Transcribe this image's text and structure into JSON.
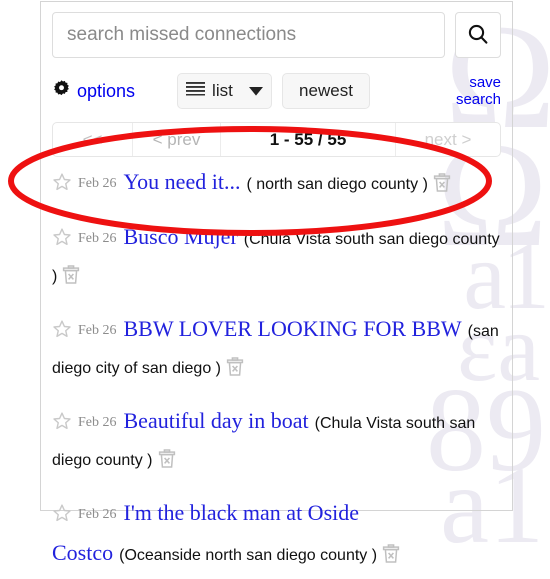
{
  "search": {
    "placeholder": "search missed connections",
    "value": "",
    "search_icon": "magnifier-icon"
  },
  "toolbar": {
    "options_label": "options",
    "options_icon": "gear-icon",
    "view_label": "list",
    "view_icon": "list-lines-icon",
    "view_caret_icon": "chevron-down-icon",
    "sort_label": "newest",
    "save_search_line1": "save",
    "save_search_line2": "search"
  },
  "pagination": {
    "first_label": "<<",
    "prev_label": "< prev",
    "range_label": "1 - 55 / 55",
    "next_label": "next >"
  },
  "results": [
    {
      "favorite_icon": "star-outline-icon",
      "date": "Feb 26",
      "title": "You need it...",
      "location": "( north san diego county )",
      "hide_icon": "trash-x-icon"
    },
    {
      "favorite_icon": "star-outline-icon",
      "date": "Feb 26",
      "title": "Busco Mujer",
      "location": "(Chula Vista south san diego county )",
      "hide_icon": "trash-x-icon"
    },
    {
      "favorite_icon": "star-outline-icon",
      "date": "Feb 26",
      "title": "BBW LOVER LOOKING FOR BBW",
      "location": "(san diego city of san diego )",
      "hide_icon": "trash-x-icon"
    },
    {
      "favorite_icon": "star-outline-icon",
      "date": "Feb 26",
      "title": "Beautiful day in boat",
      "location": "(Chula Vista south san diego county )",
      "hide_icon": "trash-x-icon"
    },
    {
      "favorite_icon": "star-outline-icon",
      "date": "Feb 26",
      "title": "I'm the black man at Oside Costco",
      "location": "(Oceanside north san diego county )",
      "hide_icon": "trash-x-icon"
    }
  ],
  "annotation": {
    "shape": "red-ellipse-highlight",
    "color": "#ee1111"
  },
  "watermark": {
    "chars": [
      "Ω",
      "Ω",
      "a1",
      "εa",
      "89",
      "a1"
    ]
  },
  "colors": {
    "link": "#0000ee",
    "title_link": "#2222dd",
    "annotation": "#ee1111",
    "muted": "#b5b5b5"
  }
}
